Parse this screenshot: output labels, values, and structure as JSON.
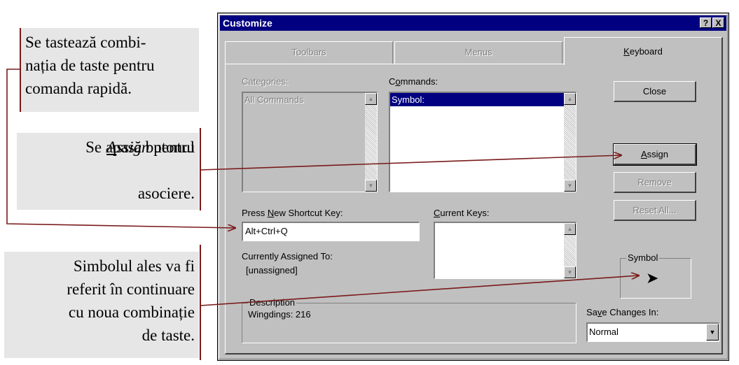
{
  "callouts": [
    {
      "lines": [
        "Se tastează combi-",
        "nația de taste pentru",
        "comanda rapidă."
      ]
    },
    {
      "lines": [
        "Se apasă butonul",
        "Assign pentru",
        "asociere."
      ]
    },
    {
      "lines": [
        "Simbolul ales va fi",
        "referit în continuare",
        "cu noua combinație",
        "de taste."
      ]
    }
  ],
  "dialog": {
    "title": "Customize",
    "help_btn": "?",
    "close_btn": "X",
    "tabs": [
      {
        "label": "Toolbars",
        "state": "disabled"
      },
      {
        "label": "Menus",
        "state": "disabled"
      },
      {
        "label": "Keyboard",
        "state": "active"
      }
    ],
    "categories_label": "Categories:",
    "categories_items": [
      "All Commands"
    ],
    "commands_label": "Commands:",
    "commands_items": [
      "Symbol:"
    ],
    "press_shortcut_label": "Press New Shortcut Key:",
    "shortcut_value": "Alt+Ctrl+Q",
    "current_keys_label": "Current Keys:",
    "assigned_label": "Currently Assigned To:",
    "assigned_value": "[unassigned]",
    "description_label": "Description",
    "description_value": "Wingdings: 216",
    "buttons": {
      "close": "Close",
      "assign": "Assign",
      "remove": "Remove",
      "reset_all": "Reset All..."
    },
    "symbol_label": "Symbol",
    "symbol_glyph": "➤",
    "save_changes_label": "Save Changes In:",
    "save_changes_value": "Normal"
  },
  "colors": {
    "titlebar": "#000080",
    "arrow": "#7a1a1a",
    "callout_bg": "#e6e6e6"
  }
}
